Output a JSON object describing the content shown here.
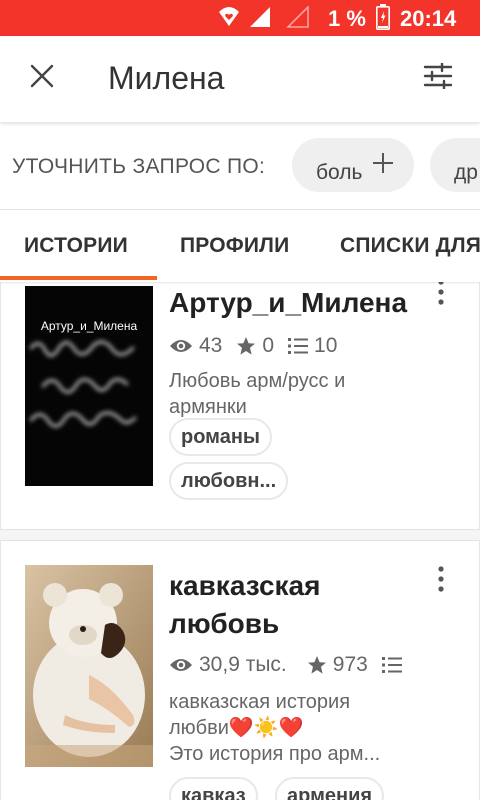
{
  "status_bar": {
    "battery_percent": "1 %",
    "time": "20:14",
    "icons": [
      "vpn-heart-icon",
      "signal-icon",
      "no-signal-icon",
      "battery-charging-icon"
    ]
  },
  "top_bar": {
    "close_icon": "close-icon",
    "query": "Милена",
    "filter_icon": "filter-sliders-icon"
  },
  "refine": {
    "label": "УТОЧНИТЬ ЗАПРОС ПО:",
    "chips": [
      {
        "label": "боль",
        "icon": "plus-icon"
      },
      {
        "label": "др",
        "icon": "plus-icon"
      }
    ]
  },
  "tabs": [
    {
      "label": "ИСТОРИИ",
      "active": true
    },
    {
      "label": "ПРОФИЛИ",
      "active": false
    },
    {
      "label": "СПИСКИ ДЛЯ",
      "active": false
    }
  ],
  "accent_color": "#f26522",
  "status_bar_color": "#f2342b",
  "stories": [
    {
      "cover_caption": "Артур_и_Милена",
      "title": "Артур_и_Милена",
      "views": "43",
      "votes": "0",
      "parts": "10",
      "description": "Любовь арм/русс и армянки",
      "tags": [
        "романы",
        "любовн..."
      ]
    },
    {
      "title_line1": "кавказская",
      "title_line2": "любовь",
      "views": "30,9 тыс.",
      "votes": "973",
      "parts": "",
      "description_line1": "кавказская история",
      "description_line2": "любви❤️☀️❤️",
      "description_line3": "Это история про арм...",
      "tags": [
        "кавказ",
        "армения"
      ]
    }
  ]
}
